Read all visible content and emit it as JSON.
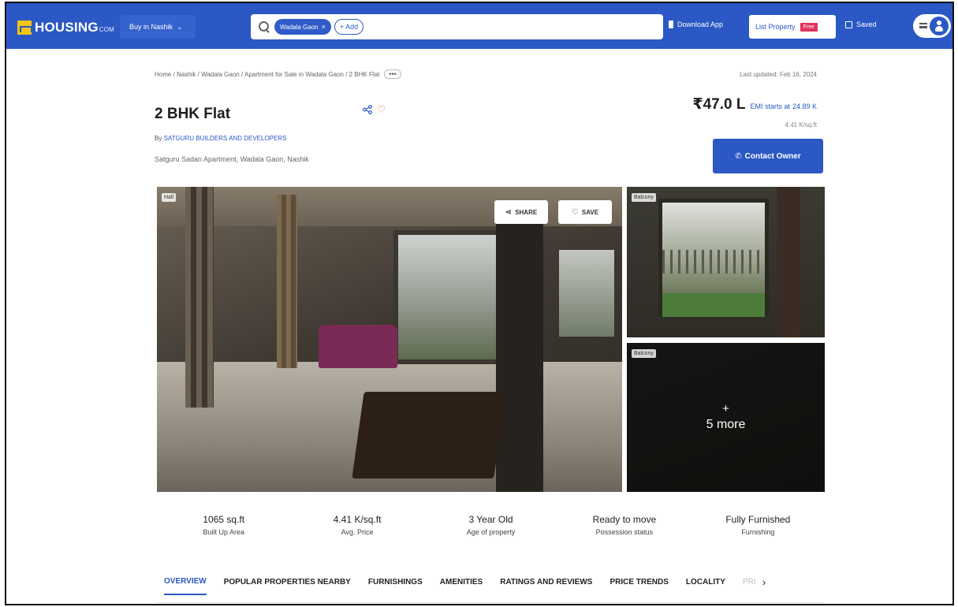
{
  "header": {
    "logo": "HOUSING",
    "logo_suffix": "COM",
    "city_select": "Buy in Nashik",
    "search_chip": "Wadala Gaon",
    "add_label": "+ Add",
    "download_app": "Download App",
    "list_property": "List Property",
    "free_badge": "Free",
    "saved": "Saved"
  },
  "breadcrumb": "Home / Nashik / Wadala Gaon / Apartment for Sale in Wadala Gaon / 2 BHK Flat",
  "breadcrumb_more": "•••",
  "last_updated": "Last updated: Feb 16, 2024",
  "listing": {
    "title": "2 BHK Flat",
    "builder_prefix": "By",
    "builder": "SATGURU BUILDERS AND DEVELOPERS",
    "address": "Satguru Sadan Apartment, Wadala Gaon, Nashik",
    "price": "₹47.0 L",
    "emi_label": "EMI starts at",
    "emi_value": "24.89 K",
    "price_per_sqft": "4.41 K/sq.ft",
    "contact_button": "Contact Owner"
  },
  "gallery": {
    "main_tag": "Hall",
    "share_label": "SHARE",
    "save_label": "SAVE",
    "side1_tag": "Balcony",
    "side2_tag": "Balcony",
    "more_plus": "+",
    "more_label": "5 more"
  },
  "stats": [
    {
      "value": "1065 sq.ft",
      "label": "Built Up Area"
    },
    {
      "value": "4.41 K/sq.ft",
      "label": "Avg. Price"
    },
    {
      "value": "3 Year Old",
      "label": "Age of property"
    },
    {
      "value": "Ready to move",
      "label": "Possession status"
    },
    {
      "value": "Fully Furnished",
      "label": "Furnishing"
    }
  ],
  "tabs": [
    "OVERVIEW",
    "POPULAR PROPERTIES NEARBY",
    "FURNISHINGS",
    "AMENITIES",
    "RATINGS AND REVIEWS",
    "PRICE TRENDS",
    "LOCALITY",
    "PRI"
  ],
  "colors": {
    "brand": "#2b58c4",
    "free_badge": "#e0325d",
    "logo_accent": "#f3c316"
  },
  "icons": [
    "search-icon",
    "close-icon",
    "phone-icon",
    "saved-icon",
    "menu-icon",
    "user-avatar-icon",
    "share-icon",
    "heart-icon",
    "chevron-right-icon"
  ]
}
